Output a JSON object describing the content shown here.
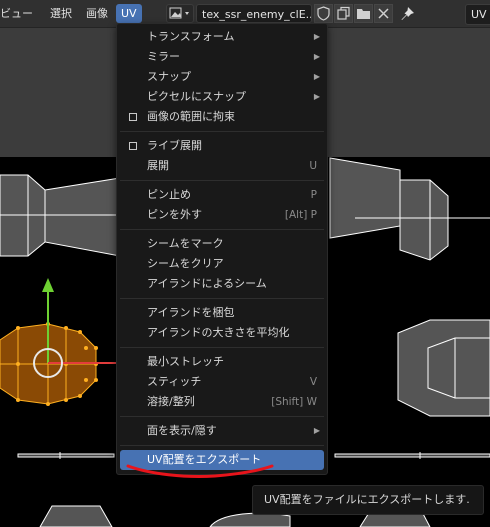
{
  "header": {
    "menus": [
      {
        "label": "ビュー"
      },
      {
        "label": "選択"
      },
      {
        "label": "画像"
      },
      {
        "label": "UV"
      }
    ],
    "image_name": "tex_ssr_enemy_clE...",
    "right_label": "UV"
  },
  "menu": {
    "items": [
      {
        "label": "トランスフォーム",
        "submenu": true
      },
      {
        "label": "ミラー",
        "submenu": true
      },
      {
        "label": "スナップ",
        "submenu": true
      },
      {
        "label": "ピクセルにスナップ",
        "submenu": true
      },
      {
        "label": "画像の範囲に拘束",
        "checkbox": true
      },
      {
        "label": "ライブ展開",
        "checkbox": true
      },
      {
        "label": "展開",
        "shortcut": "U"
      },
      {
        "label": "ピン止め",
        "shortcut": "P"
      },
      {
        "label": "ピンを外す",
        "shortcut": "[Alt] P"
      },
      {
        "label": "シームをマーク"
      },
      {
        "label": "シームをクリア"
      },
      {
        "label": "アイランドによるシーム"
      },
      {
        "label": "アイランドを梱包"
      },
      {
        "label": "アイランドの大きさを平均化"
      },
      {
        "label": "最小ストレッチ"
      },
      {
        "label": "スティッチ",
        "shortcut": "V"
      },
      {
        "label": "溶接/整列",
        "shortcut": "[Shift] W"
      },
      {
        "label": "面を表示/隠す",
        "submenu": true
      },
      {
        "label": "UV配置をエクスポート",
        "highlighted": true
      }
    ]
  },
  "tooltip": "UV配置をファイルにエクスポートします.",
  "colors": {
    "accent": "#4772b3",
    "selected_face": "#8a4a05",
    "annotation": "#e8141b",
    "gizmo_green": "#6ed132",
    "gizmo_red": "#e23c3c"
  }
}
